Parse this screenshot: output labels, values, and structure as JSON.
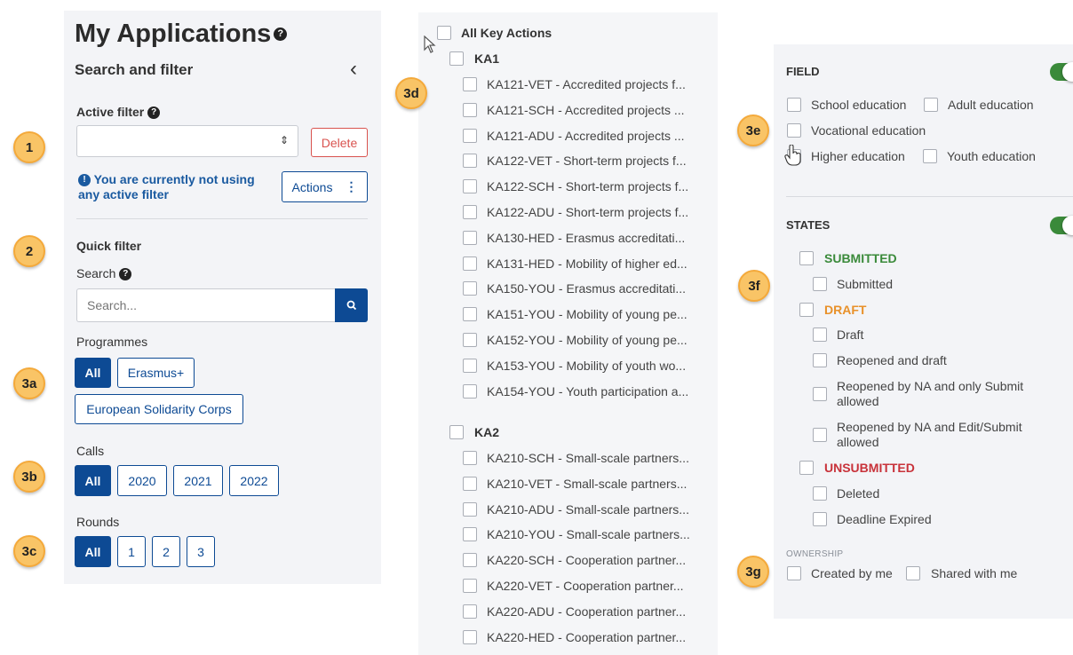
{
  "left": {
    "title": "My Applications",
    "search_filter_title": "Search and filter",
    "collapse_glyph": "‹",
    "active_filter_label": "Active filter",
    "delete_label": "Delete",
    "info_text": "You are currently not using any active filter",
    "actions_label": "Actions",
    "quick_filter_label": "Quick filter",
    "search_label": "Search",
    "search_placeholder": "Search...",
    "programmes_label": "Programmes",
    "programmes": [
      "All",
      "Erasmus+",
      "European Solidarity Corps"
    ],
    "calls_label": "Calls",
    "calls": [
      "All",
      "2020",
      "2021",
      "2022"
    ],
    "rounds_label": "Rounds",
    "rounds": [
      "All",
      "1",
      "2",
      "3"
    ]
  },
  "badges": [
    "1",
    "2",
    "3a",
    "3b",
    "3c",
    "3d",
    "3e",
    "3f",
    "3g"
  ],
  "key_actions": {
    "all_label": "All Key Actions",
    "ka1_label": "KA1",
    "ka1_items": [
      "KA121-VET - Accredited projects f...",
      "KA121-SCH - Accredited projects ...",
      "KA121-ADU - Accredited projects ...",
      "KA122-VET - Short-term projects f...",
      "KA122-SCH - Short-term projects f...",
      "KA122-ADU - Short-term projects f...",
      "KA130-HED - Erasmus accreditati...",
      "KA131-HED - Mobility of higher ed...",
      "KA150-YOU - Erasmus accreditati...",
      "KA151-YOU - Mobility of young pe...",
      "KA152-YOU - Mobility of young pe...",
      "KA153-YOU - Mobility of youth wo...",
      "KA154-YOU - Youth participation a..."
    ],
    "ka2_label": "KA2",
    "ka2_items": [
      "KA210-SCH - Small-scale partners...",
      "KA210-VET - Small-scale partners...",
      "KA210-ADU - Small-scale partners...",
      "KA210-YOU - Small-scale partners...",
      "KA220-SCH - Cooperation partner...",
      "KA220-VET - Cooperation partner...",
      "KA220-ADU - Cooperation partner...",
      "KA220-HED - Cooperation partner..."
    ]
  },
  "field": {
    "title": "FIELD",
    "items": [
      "School education",
      "Adult education",
      "Vocational education",
      "Higher education",
      "Youth education"
    ]
  },
  "states": {
    "title": "STATES",
    "submitted_group": "SUBMITTED",
    "submitted_items": [
      "Submitted"
    ],
    "draft_group": "DRAFT",
    "draft_items": [
      "Draft",
      "Reopened and draft",
      "Reopened by NA and only Submit allowed",
      "Reopened by NA and Edit/Submit allowed"
    ],
    "unsubmitted_group": "UNSUBMITTED",
    "unsubmitted_items": [
      "Deleted",
      "Deadline Expired"
    ]
  },
  "ownership": {
    "title": "OWNERSHIP",
    "items": [
      "Created by me",
      "Shared with me"
    ]
  },
  "colors": {
    "primary": "#0d4a94",
    "submitted": "#3a8a3a",
    "draft": "#e8912a",
    "unsubmitted": "#c8323a",
    "badge": "#f9c466"
  }
}
